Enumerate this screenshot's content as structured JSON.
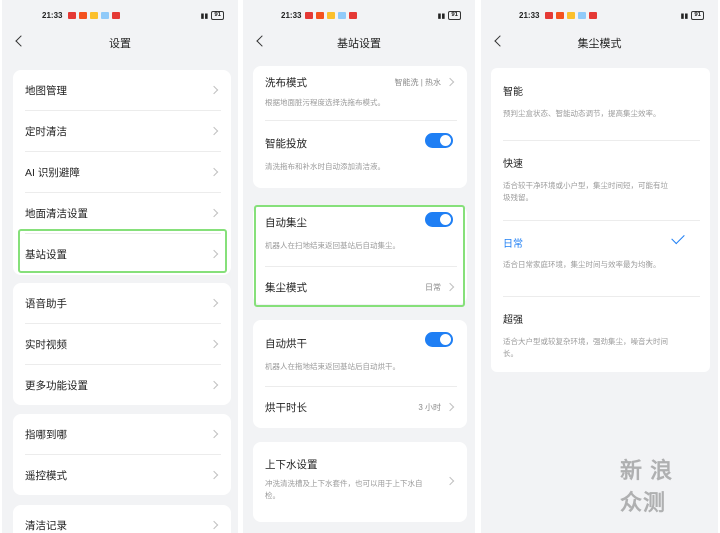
{
  "status_bar": {
    "time": "21:33",
    "battery": "91"
  },
  "screen1": {
    "title": "设置",
    "group1": [
      "地图管理",
      "定时清洁",
      "AI 识别避障",
      "地面清洁设置",
      "基站设置"
    ],
    "group2": [
      "语音助手",
      "实时视频",
      "更多功能设置"
    ],
    "group3": [
      "指哪到哪",
      "遥控模式"
    ],
    "group4": [
      "清洁记录"
    ],
    "highlighted": "基站设置"
  },
  "screen2": {
    "title": "基站设置",
    "mop_wash_mode": {
      "label": "洗布模式",
      "value": "智能洗 | 热水",
      "desc": "根据地面脏污程度选择洗拖布模式。"
    },
    "smart_dispense": {
      "label": "智能投放",
      "desc": "清洗拖布和补水时自动添加清洁液。",
      "on": true
    },
    "auto_dust": {
      "label": "自动集尘",
      "desc": "机器人在扫地结束返回基站后自动集尘。",
      "on": true
    },
    "dust_mode": {
      "label": "集尘模式",
      "value": "日常"
    },
    "auto_dry": {
      "label": "自动烘干",
      "desc": "机器人在拖地结束返回基站后自动烘干。",
      "on": true
    },
    "dry_duration": {
      "label": "烘干时长",
      "value": "3 小时"
    },
    "water_setup": {
      "label": "上下水设置",
      "desc": "冲洗清洗槽及上下水套件，也可以用于上下水自检。"
    }
  },
  "screen3": {
    "title": "集尘模式",
    "options": [
      {
        "label": "智能",
        "desc": "预判尘盒状态、智能动态调节，提高集尘效率。",
        "selected": false
      },
      {
        "label": "快速",
        "desc": "适合较干净环境或小户型，集尘时间短，可能有垃圾残留。",
        "selected": false
      },
      {
        "label": "日常",
        "desc": "适合日常家庭环境，集尘时间与效率最为均衡。",
        "selected": true
      },
      {
        "label": "超强",
        "desc": "适合大户型或较复杂环境，强劲集尘，噪音大时间长。",
        "selected": false
      }
    ],
    "selected_color": "#1f7ff4"
  },
  "watermark": "新 浪 众测",
  "colors": {
    "accent": "#1f7ff4",
    "highlight": "#86e07a"
  }
}
